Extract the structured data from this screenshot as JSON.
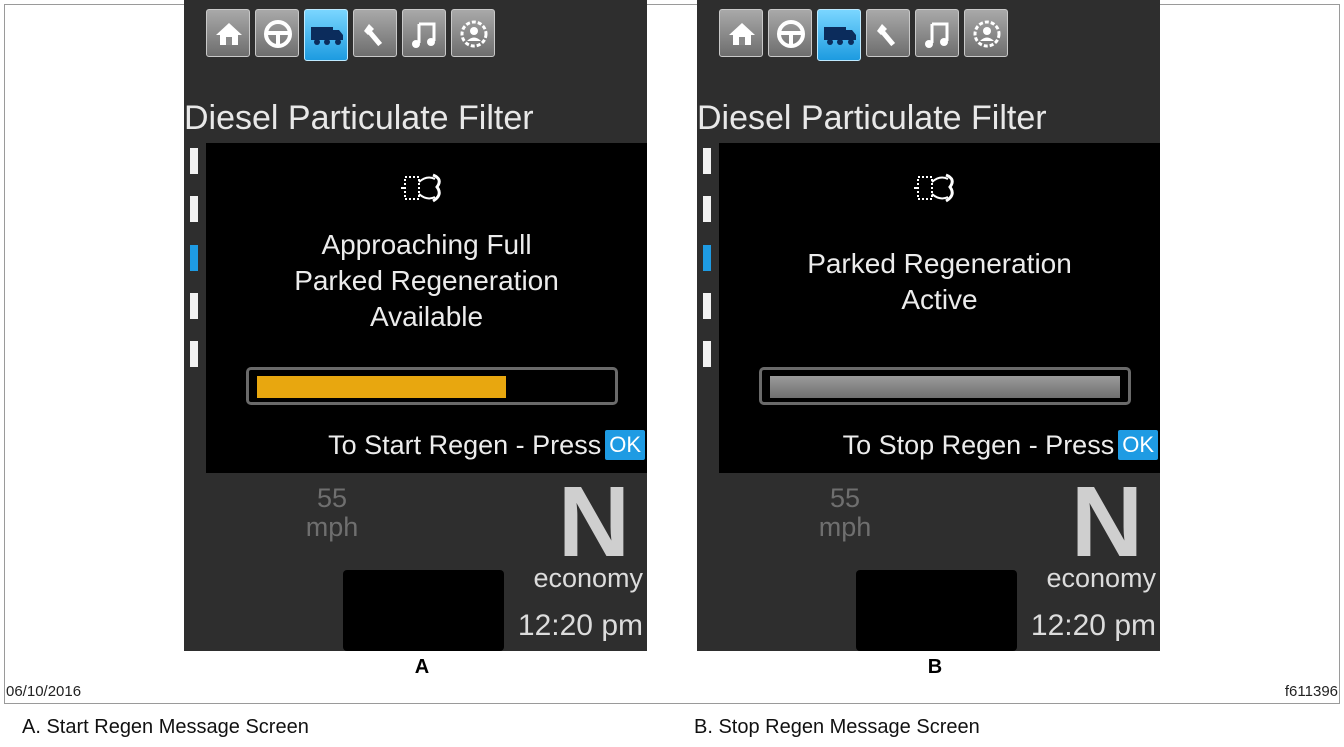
{
  "screens": [
    {
      "id": "a",
      "title": "Diesel Particulate Filter",
      "message_lines": [
        "Approaching Full",
        "Parked Regeneration",
        "Available"
      ],
      "progress": 0.71,
      "progress_color": "#e8a70f",
      "command_text": "To Start Regen - Press",
      "ok_label": "OK",
      "speed_value": "55",
      "speed_unit": "mph",
      "gear": "N",
      "mode": "economy",
      "clock": "12:20 pm",
      "active_tab": "truck-icon",
      "active_side_indicator": 3
    },
    {
      "id": "b",
      "title": "Diesel Particulate Filter",
      "message_lines": [
        "Parked Regeneration",
        "Active"
      ],
      "progress": 1.0,
      "progress_color": "#8a8a8a",
      "command_text": "To Stop Regen - Press",
      "ok_label": "OK",
      "speed_value": "55",
      "speed_unit": "mph",
      "gear": "N",
      "mode": "economy",
      "clock": "12:20 pm",
      "active_tab": "truck-icon",
      "active_side_indicator": 3
    }
  ],
  "tabs": [
    "home-icon",
    "steering-wheel-icon",
    "truck-icon",
    "wrench-icon",
    "music-icon",
    "settings-icon"
  ],
  "figure": {
    "label_a": "A",
    "label_b": "B",
    "date": "06/10/2016",
    "figure_id": "f611396",
    "caption_a": "A.  Start Regen Message Screen",
    "caption_b": "B.  Stop Regen Message Screen"
  },
  "colors": {
    "accent_blue": "#1e9be3",
    "amber": "#e8a70f",
    "screen_bg": "#2e2e2e"
  }
}
